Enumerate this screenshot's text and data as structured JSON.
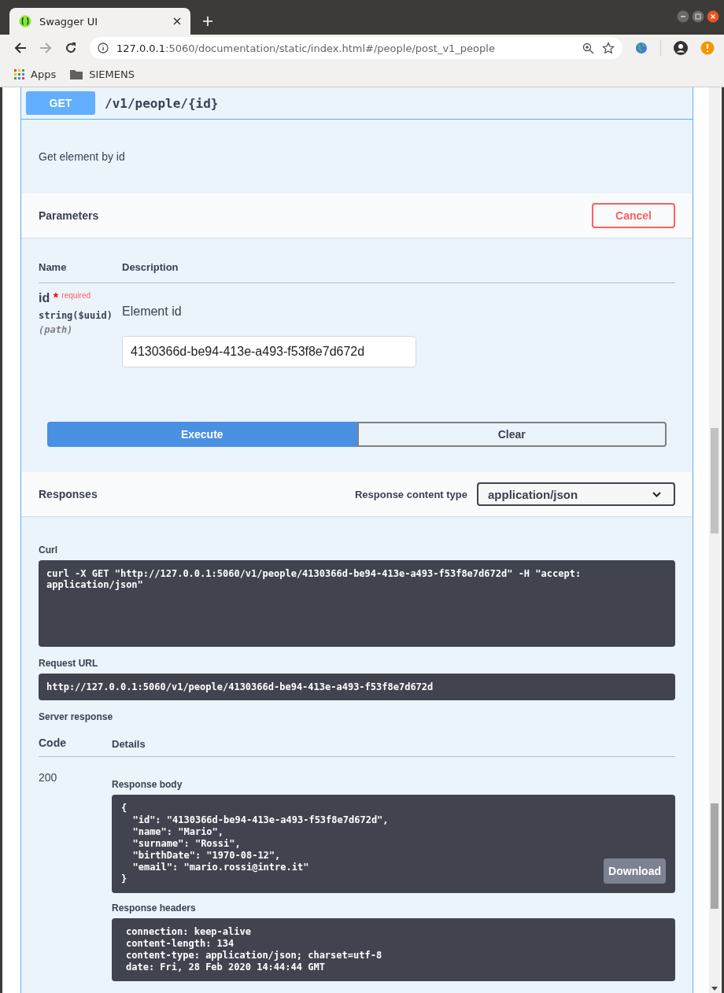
{
  "browser": {
    "tab_title": "Swagger UI",
    "url_host": "127.0.0.1",
    "url_rest": ":5060/documentation/static/index.html#/people/post_v1_people",
    "bookmarks": [
      "Apps",
      "SIEMENS"
    ]
  },
  "operation": {
    "method": "GET",
    "path": "/v1/people/{id}",
    "description": "Get element by id"
  },
  "parameters": {
    "title": "Parameters",
    "cancel": "Cancel",
    "col_name": "Name",
    "col_description": "Description",
    "param": {
      "name": "id",
      "star": "*",
      "required": "required",
      "type": "string($uuid)",
      "location": "(path)",
      "description": "Element id",
      "value": "4130366d-be94-413e-a493-f53f8e7d672d"
    }
  },
  "actions": [
    "Execute",
    "Clear"
  ],
  "responses": {
    "title": "Responses",
    "content_type_label": "Response content type",
    "content_type": "application/json",
    "curl_label": "Curl",
    "curl": "curl -X GET \"http://127.0.0.1:5060/v1/people/4130366d-be94-413e-a493-f53f8e7d672d\" -H \"accept: application/json\"",
    "request_url_label": "Request URL",
    "request_url": "http://127.0.0.1:5060/v1/people/4130366d-be94-413e-a493-f53f8e7d672d",
    "server_response_label": "Server response",
    "col_code": "Code",
    "col_details": "Details",
    "code": "200",
    "body_label": "Response body",
    "body": "{\n  \"id\": \"4130366d-be94-413e-a493-f53f8e7d672d\",\n  \"name\": \"Mario\",\n  \"surname\": \"Rossi\",\n  \"birthDate\": \"1970-08-12\",\n  \"email\": \"mario.rossi@intre.it\"\n}",
    "download": "Download",
    "headers_label": "Response headers",
    "headers": "connection: keep-alive\ncontent-length: 134\ncontent-type: application/json; charset=utf-8\ndate: Fri, 28 Feb 2020 14:44:44 GMT"
  }
}
